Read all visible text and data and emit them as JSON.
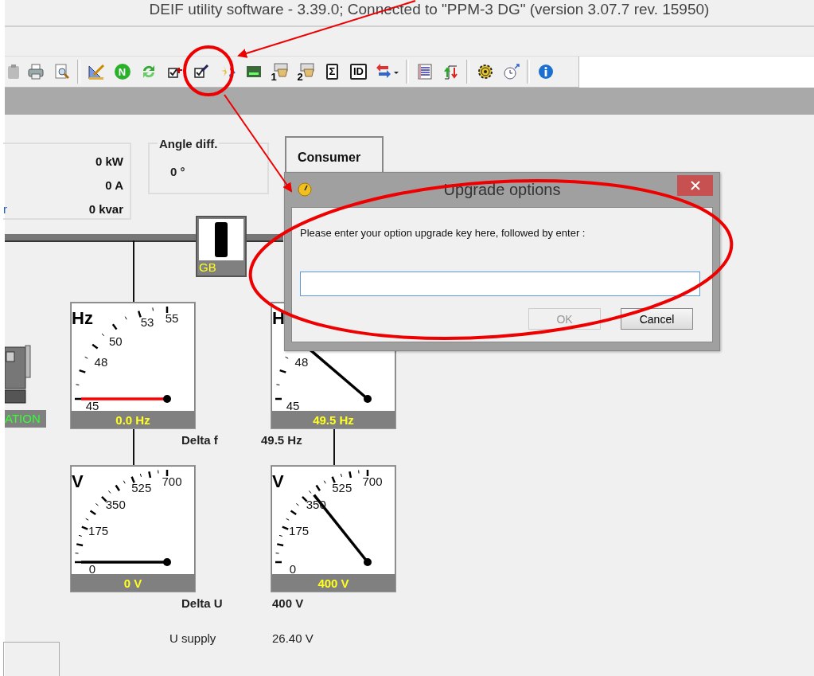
{
  "window": {
    "title": "DEIF utility software - 3.39.0; Connected to \"PPM-3 DG\" (version 3.07.7 rev. 15950)"
  },
  "toolbar": [
    {
      "kind": "clipboard"
    },
    {
      "kind": "printer"
    },
    {
      "kind": "preview"
    },
    {
      "kind": "separator"
    },
    {
      "kind": "pen-ruler"
    },
    {
      "kind": "badge",
      "label": "N"
    },
    {
      "kind": "refresh"
    },
    {
      "kind": "check-cross"
    },
    {
      "kind": "check-pen"
    },
    {
      "kind": "sparkle"
    },
    {
      "kind": "display"
    },
    {
      "kind": "keypad",
      "label": "1"
    },
    {
      "kind": "keypad",
      "label": "2"
    },
    {
      "kind": "boxed",
      "label": "Σ"
    },
    {
      "kind": "boxed",
      "label": "ID"
    },
    {
      "kind": "swap-dropdown"
    },
    {
      "kind": "separator"
    },
    {
      "kind": "list"
    },
    {
      "kind": "updown"
    },
    {
      "kind": "separator"
    },
    {
      "kind": "gear"
    },
    {
      "kind": "clock"
    },
    {
      "kind": "separator"
    },
    {
      "kind": "info"
    }
  ],
  "measurements": [
    {
      "value": "0 kW"
    },
    {
      "value": "0 A"
    },
    {
      "label": "r",
      "value": "0 kvar"
    }
  ],
  "angle_diff": {
    "label": "Angle diff.",
    "value": "0 °"
  },
  "consumer_tab": {
    "label": "Consumer"
  },
  "breaker": {
    "label": "GB"
  },
  "generator": {
    "status": "ATION"
  },
  "gauges": [
    {
      "kind": "frequency",
      "unit": "Hz",
      "ticks": [
        "45",
        "48",
        "50",
        "53",
        "55"
      ],
      "alarm": true,
      "reading": "0.0 Hz"
    },
    {
      "kind": "frequency",
      "unit": "H",
      "ticks": [
        "45",
        "48"
      ],
      "alarm": false,
      "reading": "49.5 Hz"
    },
    {
      "kind": "voltage",
      "unit": "V",
      "ticks": [
        "0",
        "175",
        "350",
        "525",
        "700"
      ],
      "alarm": false,
      "reading": "0 V"
    },
    {
      "kind": "voltage",
      "unit": "V",
      "ticks": [
        "0",
        "175",
        "350",
        "525",
        "700"
      ],
      "alarm": false,
      "reading": "400 V"
    }
  ],
  "readings": [
    {
      "label": "Delta f",
      "value": "49.5 Hz",
      "emphasis": true
    },
    {
      "label": "Delta U",
      "value": "400 V",
      "emphasis": true
    },
    {
      "label": "U supply",
      "value": "26.40 V",
      "emphasis": false
    }
  ],
  "dialog": {
    "title": "Upgrade options",
    "prompt": "Please enter your option upgrade key here, followed by enter :",
    "buttons": [
      {
        "label": "OK",
        "disabled": true
      },
      {
        "label": "Cancel",
        "disabled": false
      }
    ]
  }
}
